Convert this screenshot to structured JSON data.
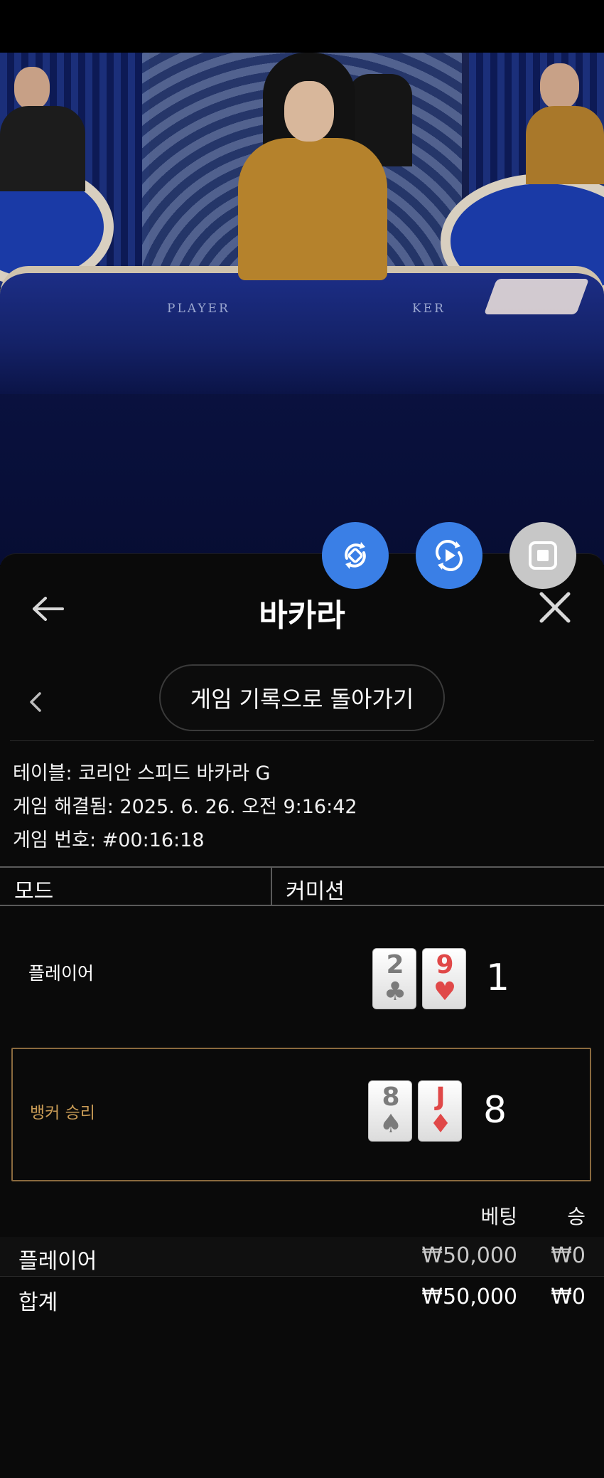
{
  "header": {
    "title": "바카라"
  },
  "back_to_history": {
    "label": "게임 기록으로 돌아가기"
  },
  "info": {
    "table": "테이블: 코리안 스피드 바카라 G",
    "resolved": "게임 해결됨: 2025. 6. 26. 오전 9:16:42",
    "game_number": "게임 번호: #00:16:18"
  },
  "video": {
    "table_text_left": "PLAYER",
    "table_text_right": "KER"
  },
  "mode_row": {
    "col1": "모드",
    "col2": "커미션"
  },
  "hands": {
    "player": {
      "label": "플레이어",
      "cards": [
        {
          "rank": "2",
          "suit": "♣",
          "color": "black"
        },
        {
          "rank": "9",
          "suit": "♥",
          "color": "red"
        }
      ],
      "score": "1"
    },
    "banker": {
      "label": "뱅커 승리",
      "cards": [
        {
          "rank": "8",
          "suit": "♠",
          "color": "black"
        },
        {
          "rank": "J",
          "suit": "♦",
          "color": "red"
        }
      ],
      "score": "8"
    }
  },
  "bets": {
    "headers": {
      "bet": "베팅",
      "win": "승"
    },
    "rows": [
      {
        "name": "플레이어",
        "amount": "₩50,000",
        "win": "₩0"
      },
      {
        "name": "합계",
        "amount": "₩50,000",
        "win": "₩0"
      }
    ]
  },
  "colors": {
    "accent_blue": "#3a7fe6",
    "banker_gold": "#c79a55",
    "card_red": "#e04848"
  },
  "icons": [
    "rotate-icon",
    "replay-icon",
    "stop-icon",
    "back-arrow-icon",
    "close-icon",
    "chevron-left-icon"
  ]
}
